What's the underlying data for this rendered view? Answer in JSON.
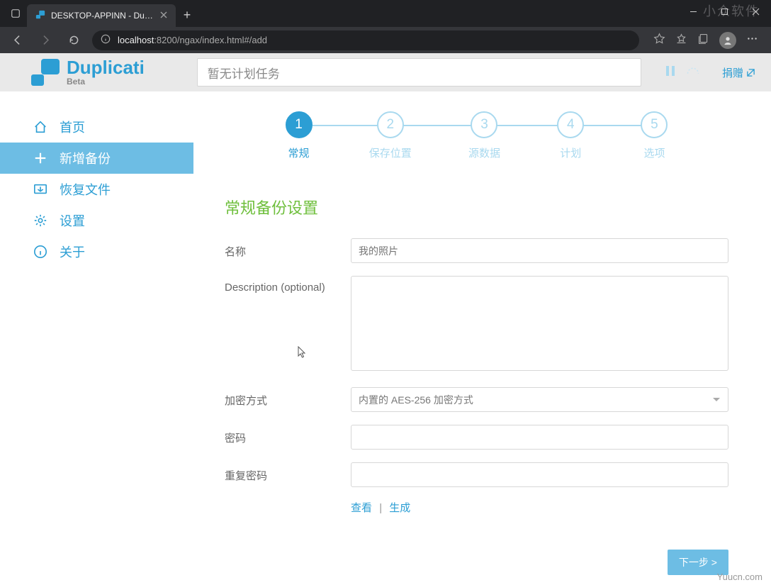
{
  "browser": {
    "tab_title": "DESKTOP-APPINN - Duplicati",
    "url_host": "localhost",
    "url_port_path": ":8200/ngax/index.html#/add"
  },
  "header": {
    "brand": "Duplicati",
    "beta": "Beta",
    "schedule_placeholder": "暂无计划任务",
    "donate": "捐赠"
  },
  "sidebar": {
    "items": [
      {
        "label": "首页"
      },
      {
        "label": "新增备份"
      },
      {
        "label": "恢复文件"
      },
      {
        "label": "设置"
      },
      {
        "label": "关于"
      }
    ]
  },
  "stepper": {
    "steps": [
      {
        "num": "1",
        "label": "常规"
      },
      {
        "num": "2",
        "label": "保存位置"
      },
      {
        "num": "3",
        "label": "源数据"
      },
      {
        "num": "4",
        "label": "计划"
      },
      {
        "num": "5",
        "label": "选项"
      }
    ]
  },
  "form": {
    "section_title": "常规备份设置",
    "name_label": "名称",
    "name_placeholder": "我的照片",
    "name_value": "",
    "desc_label": "Description (optional)",
    "encrypt_label": "加密方式",
    "encrypt_selected": "内置的 AES-256 加密方式",
    "password_label": "密码",
    "password_repeat_label": "重复密码",
    "link_show": "查看",
    "link_generate": "生成",
    "next_button": "下一步 >"
  },
  "watermark": "小众软件",
  "watermark2": "Yuucn.com"
}
